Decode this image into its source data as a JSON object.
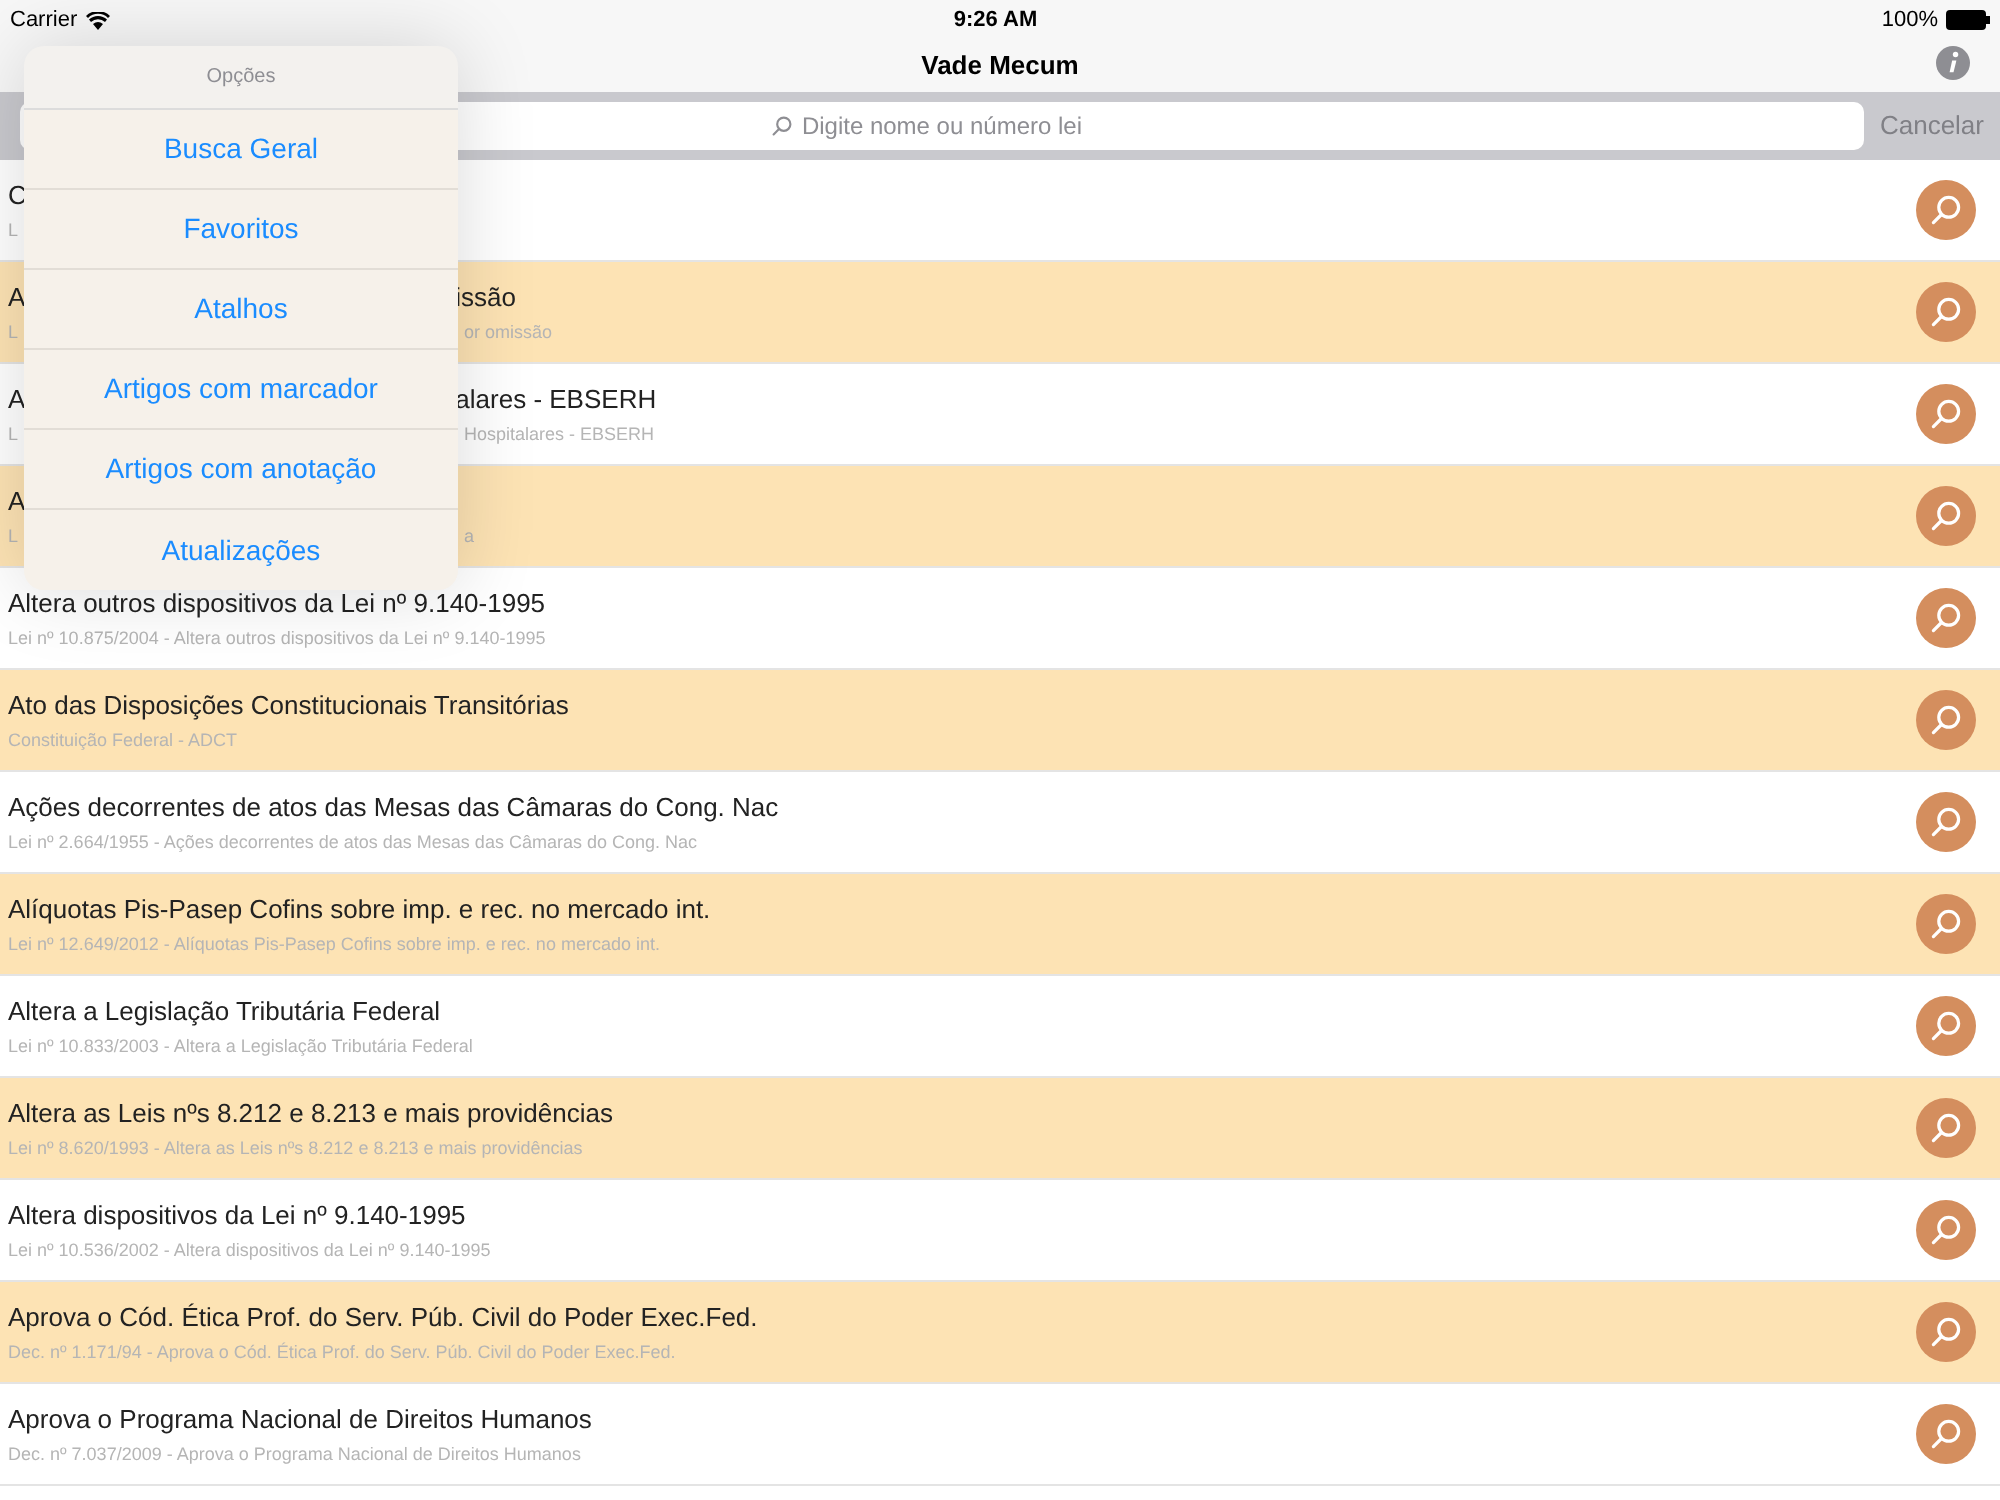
{
  "status_bar": {
    "carrier": "Carrier",
    "time": "9:26 AM",
    "battery": "100%"
  },
  "nav_bar": {
    "title": "Vade Mecum"
  },
  "search": {
    "placeholder": "Digite nome ou número lei",
    "cancel": "Cancelar",
    "cancel_disabled": true
  },
  "rows": [
    {
      "title": "C",
      "subtitle": "L",
      "shaded": false
    },
    {
      "title": "A",
      "title_tail": "issão",
      "subtitle": "L",
      "subtitle_tail": "or omissão",
      "shaded": true
    },
    {
      "title": "A",
      "title_tail": "alares - EBSERH",
      "subtitle": "L",
      "subtitle_tail": "Hospitalares - EBSERH",
      "shaded": false
    },
    {
      "title": "A",
      "subtitle": "L",
      "subtitle_tail": "a",
      "shaded": true
    },
    {
      "title": "Altera outros dispositivos da Lei nº 9.140-1995",
      "subtitle": "Lei nº 10.875/2004 - Altera outros dispositivos da Lei nº 9.140-1995",
      "shaded": false
    },
    {
      "title": "Ato das Disposições Constitucionais Transitórias",
      "subtitle": "Constituição Federal - ADCT",
      "shaded": true
    },
    {
      "title": "Ações decorrentes de atos das Mesas das Câmaras do Cong. Nac",
      "subtitle": "Lei nº 2.664/1955 - Ações decorrentes de atos das Mesas das Câmaras do Cong. Nac",
      "shaded": false
    },
    {
      "title": "Alíquotas Pis-Pasep Cofins sobre imp. e rec. no mercado int.",
      "subtitle": "Lei nº 12.649/2012 - Alíquotas Pis-Pasep Cofins sobre imp. e rec. no mercado int.",
      "shaded": true
    },
    {
      "title": "Altera a Legislação Tributária Federal",
      "subtitle": "Lei nº 10.833/2003 - Altera a Legislação Tributária Federal",
      "shaded": false
    },
    {
      "title": "Altera as Leis nºs 8.212 e 8.213 e mais providências",
      "subtitle": "Lei nº 8.620/1993 - Altera as Leis nºs 8.212 e 8.213 e mais providências",
      "shaded": true
    },
    {
      "title": "Altera dispositivos da Lei nº 9.140-1995",
      "subtitle": "Lei nº 10.536/2002 - Altera dispositivos da Lei nº 9.140-1995",
      "shaded": false
    },
    {
      "title": "Aprova o Cód. Ética Prof. do Serv. Púb. Civil do Poder Exec.Fed.",
      "subtitle": "Dec. nº 1.171/94 - Aprova o Cód. Ética Prof. do Serv. Púb. Civil do Poder Exec.Fed.",
      "shaded": true
    },
    {
      "title": "Aprova o Programa Nacional de Direitos Humanos",
      "subtitle": "Dec. nº 7.037/2009 - Aprova o Programa Nacional de Direitos Humanos",
      "shaded": false
    }
  ],
  "popover": {
    "title": "Opções",
    "items": [
      "Busca Geral",
      "Favoritos",
      "Atalhos",
      "Artigos com marcador",
      "Artigos com anotação",
      "Atualizações"
    ]
  }
}
